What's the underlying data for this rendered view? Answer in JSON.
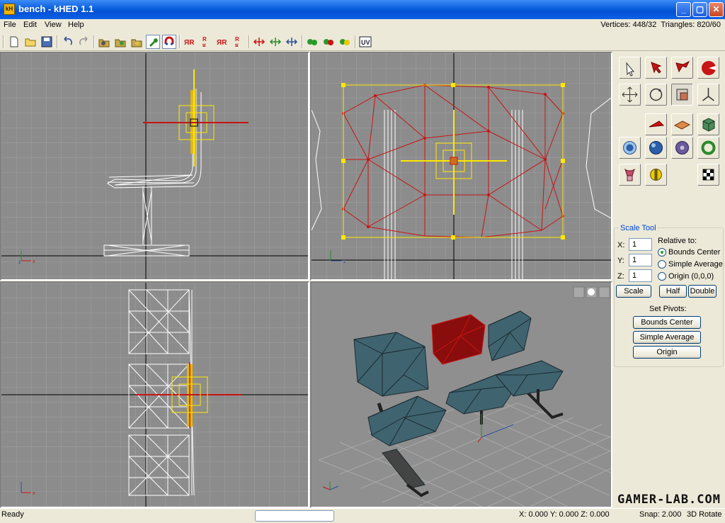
{
  "window": {
    "title": "bench - kHED 1.1",
    "app_icon_text": "kH",
    "min": "_",
    "max": "▢",
    "close": "✕"
  },
  "menu": {
    "items": [
      "File",
      "Edit",
      "View",
      "Help"
    ],
    "vertices_label": "Vertices: 448/32",
    "triangles_label": "Triangles: 820/60"
  },
  "toolbar": {
    "uv_label": "UV"
  },
  "scale_tool": {
    "title": "Scale Tool",
    "x_label": "X:",
    "y_label": "Y:",
    "z_label": "Z:",
    "x_value": "1",
    "y_value": "1",
    "z_value": "1",
    "relative_to": "Relative to:",
    "options": [
      "Bounds Center",
      "Simple Average",
      "Origin (0,0,0)"
    ],
    "selected": "Bounds Center",
    "scale_button": "Scale",
    "half_button": "Half",
    "double_button": "Double",
    "set_pivots": "Set Pivots:",
    "pivot_buttons": [
      "Bounds Center",
      "Simple Average",
      "Origin"
    ]
  },
  "status": {
    "left": "Ready",
    "coords": "X: 0.000  Y: 0.000  Z: 0.000",
    "snap": "Snap: 2.000",
    "mode": "3D Rotate"
  },
  "watermark": "GAMER-LAB.COM",
  "colors": {
    "select_red": "#c81414",
    "pivot_yellow": "#ffe800",
    "seat_blue": "#3f6470",
    "seat_selected": "#8a0d0d"
  }
}
